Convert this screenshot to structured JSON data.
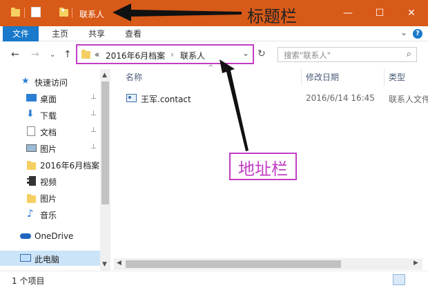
{
  "window": {
    "title": "联系人",
    "minimize_glyph": "—",
    "maximize_glyph": "☐",
    "close_glyph": "✕"
  },
  "annotations": {
    "title_bar": "标题栏",
    "address_bar": "地址栏"
  },
  "ribbon": {
    "tabs": [
      "文件",
      "主页",
      "共享",
      "查看"
    ],
    "help_glyph": "?",
    "expand_glyph": "⌄"
  },
  "nav": {
    "back": "←",
    "forward": "→",
    "recent": "⌄",
    "up": "↑"
  },
  "address": {
    "overflow": "«",
    "crumbs": [
      "2016年6月档案",
      "联系人"
    ],
    "separator": "›",
    "dropdown": "⌄",
    "refresh": "↻"
  },
  "search": {
    "placeholder": "搜索\"联系人\"",
    "icon": "search-icon"
  },
  "sidebar": {
    "items": [
      {
        "label": "快速访问",
        "icon": "star-icon",
        "pinned": false
      },
      {
        "label": "桌面",
        "icon": "desktop-icon",
        "pinned": true
      },
      {
        "label": "下载",
        "icon": "download-icon",
        "pinned": true
      },
      {
        "label": "文档",
        "icon": "document-icon",
        "pinned": true
      },
      {
        "label": "图片",
        "icon": "pictures-icon",
        "pinned": true
      },
      {
        "label": "2016年6月档案",
        "icon": "folder-icon",
        "pinned": false
      },
      {
        "label": "视频",
        "icon": "video-icon",
        "pinned": false
      },
      {
        "label": "图片",
        "icon": "folder-icon",
        "pinned": false
      },
      {
        "label": "音乐",
        "icon": "music-icon",
        "pinned": false
      },
      {
        "label": "OneDrive",
        "icon": "cloud-icon",
        "pinned": false
      },
      {
        "label": "此电脑",
        "icon": "computer-icon",
        "pinned": false
      }
    ],
    "pin_glyph": "📌"
  },
  "columns": {
    "name": "名称",
    "modified": "修改日期",
    "type": "类型",
    "sort_glyph": "^"
  },
  "files": [
    {
      "name": "王军.contact",
      "modified": "2016/6/14 16:45",
      "type": "联系人文件"
    }
  ],
  "status": {
    "count": "1 个项目"
  },
  "colors": {
    "titlebar": "#d85a18",
    "accent": "#1979ca",
    "annotation": "#c23cc4"
  }
}
